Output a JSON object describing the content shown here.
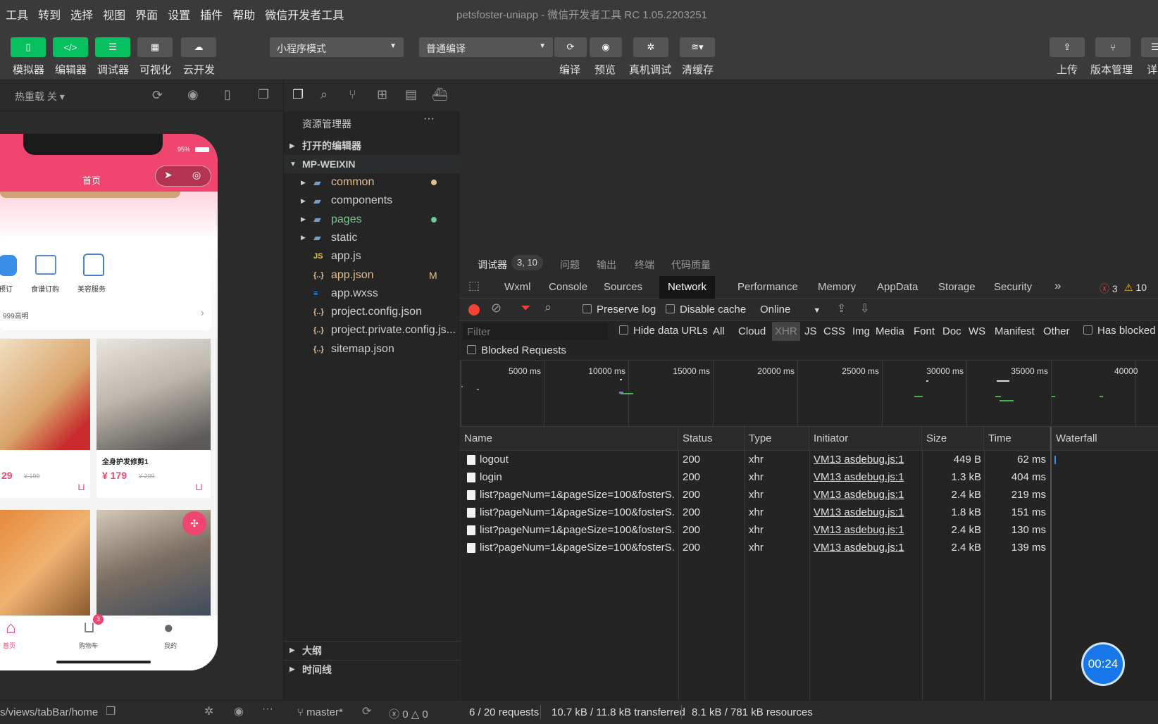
{
  "menubar": {
    "items": [
      "工具",
      "转到",
      "选择",
      "视图",
      "界面",
      "设置",
      "插件",
      "帮助",
      "微信开发者工具"
    ],
    "window_title": "petsfoster-uniapp - 微信开发者工具 RC 1.05.2203251"
  },
  "toolbar": {
    "left_buttons": [
      "模拟器",
      "编辑器",
      "调试器",
      "可视化",
      "云开发"
    ],
    "mode_select": "小程序模式",
    "compile_select": "普通编译",
    "mid_buttons": [
      "编译",
      "预览",
      "真机调试",
      "清缓存"
    ],
    "right_buttons": [
      "上传",
      "版本管理",
      "详"
    ]
  },
  "simulator": {
    "hot_reload": "热重载 关",
    "phone": {
      "battery": "95%",
      "nav_title": "首页",
      "categories": [
        "预订",
        "食谱订购",
        "美容服务"
      ],
      "notice": "999高明",
      "product_title": "全身护发修剪1",
      "price_left": "29",
      "orig_left": "¥ 199",
      "price_right": "¥ 179",
      "orig_right": "¥ 209",
      "tabbar": [
        "首页",
        "购物车",
        "我的"
      ],
      "cart_badge": "3"
    },
    "path": "s/views/tabBar/home"
  },
  "explorer": {
    "title": "资源管理器",
    "more": "···",
    "open_editors": "打开的编辑器",
    "project": "MP-WEIXIN",
    "items": [
      {
        "name": "common",
        "type": "folder",
        "color": "#e2c08d"
      },
      {
        "name": "components",
        "type": "folder",
        "color": "#cfcfcf"
      },
      {
        "name": "pages",
        "type": "folder",
        "color": "#73c991"
      },
      {
        "name": "static",
        "type": "folder",
        "color": "#cfcfcf"
      },
      {
        "name": "app.js",
        "type": "js",
        "color": "#cfcfcf"
      },
      {
        "name": "app.json",
        "type": "json",
        "color": "#e2c08d",
        "badge": "M"
      },
      {
        "name": "app.wxss",
        "type": "css",
        "color": "#cfcfcf"
      },
      {
        "name": "project.config.json",
        "type": "json",
        "color": "#cfcfcf"
      },
      {
        "name": "project.private.config.js...",
        "type": "json",
        "color": "#cfcfcf"
      },
      {
        "name": "sitemap.json",
        "type": "json",
        "color": "#cfcfcf"
      }
    ],
    "outline": "大纲",
    "timeline": "时间线",
    "branch": "master*",
    "problems_errors": "0",
    "problems_warnings": "0"
  },
  "devtools": {
    "top_tabs": [
      "调试器",
      "问题",
      "输出",
      "终端",
      "代码质量"
    ],
    "debugger_badge": "3, 10",
    "panel_tabs": [
      "Wxml",
      "Console",
      "Sources",
      "Network",
      "Performance",
      "Memory",
      "AppData",
      "Storage",
      "Security"
    ],
    "active_panel": "Network",
    "more_tabs": "»",
    "error_count": "3",
    "warning_count": "10",
    "preserve_log": "Preserve log",
    "disable_cache": "Disable cache",
    "throttle": "Online",
    "filter_placeholder": "Filter",
    "hide_data_urls": "Hide data URLs",
    "filter_types": [
      "All",
      "Cloud",
      "XHR",
      "JS",
      "CSS",
      "Img",
      "Media",
      "Font",
      "Doc",
      "WS",
      "Manifest",
      "Other"
    ],
    "active_filter": "XHR",
    "has_blocked": "Has blocked",
    "blocked_requests": "Blocked Requests",
    "timeline_ticks": [
      "5000 ms",
      "10000 ms",
      "15000 ms",
      "20000 ms",
      "25000 ms",
      "30000 ms",
      "35000 ms",
      "40000"
    ],
    "columns": [
      "Name",
      "Status",
      "Type",
      "Initiator",
      "Size",
      "Time",
      "Waterfall"
    ],
    "requests": [
      {
        "name": "logout",
        "status": "200",
        "type": "xhr",
        "initiator": "VM13 asdebug.js:1",
        "size": "449 B",
        "time": "62 ms"
      },
      {
        "name": "login",
        "status": "200",
        "type": "xhr",
        "initiator": "VM13 asdebug.js:1",
        "size": "1.3 kB",
        "time": "404 ms"
      },
      {
        "name": "list?pageNum=1&pageSize=100&fosterS...",
        "status": "200",
        "type": "xhr",
        "initiator": "VM13 asdebug.js:1",
        "size": "2.4 kB",
        "time": "219 ms"
      },
      {
        "name": "list?pageNum=1&pageSize=100&fosterS...",
        "status": "200",
        "type": "xhr",
        "initiator": "VM13 asdebug.js:1",
        "size": "1.8 kB",
        "time": "151 ms"
      },
      {
        "name": "list?pageNum=1&pageSize=100&fosterS...",
        "status": "200",
        "type": "xhr",
        "initiator": "VM13 asdebug.js:1",
        "size": "2.4 kB",
        "time": "130 ms"
      },
      {
        "name": "list?pageNum=1&pageSize=100&fosterS...",
        "status": "200",
        "type": "xhr",
        "initiator": "VM13 asdebug.js:1",
        "size": "2.4 kB",
        "time": "139 ms"
      }
    ],
    "summary": {
      "requests": "6 / 20 requests",
      "transferred": "10.7 kB / 11.8 kB transferred",
      "resources": "8.1 kB / 781 kB resources"
    },
    "timer": "00:24"
  },
  "colors": {
    "accent_green": "#07c160",
    "brand_pink": "#f0456e",
    "record_red": "#f44336"
  }
}
